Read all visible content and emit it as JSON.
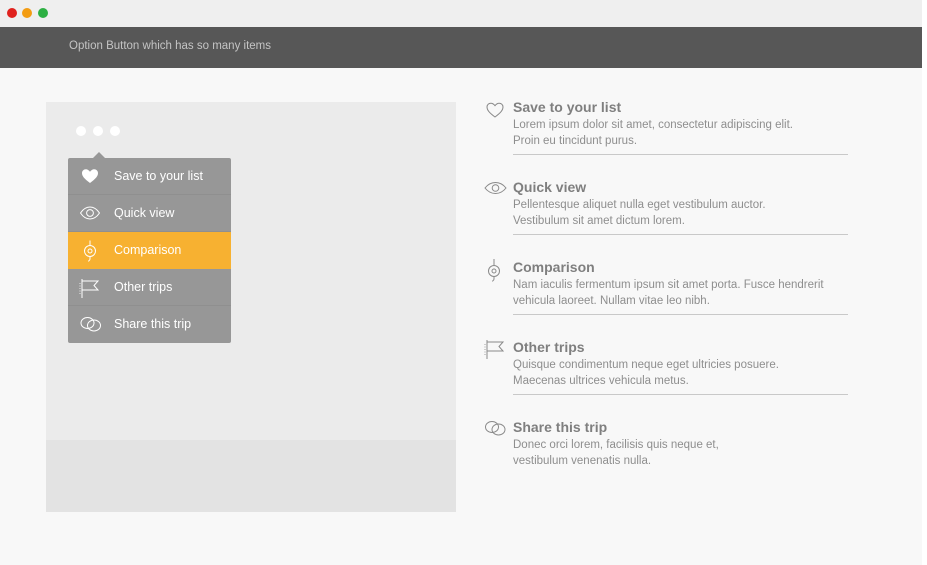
{
  "window": {
    "controls": [
      "close",
      "minimize",
      "maximize"
    ]
  },
  "header": {
    "title": "Option Button which has so many items"
  },
  "menu": {
    "items": [
      {
        "label": "Save to your list",
        "icon": "heart-icon",
        "active": false
      },
      {
        "label": "Quick view",
        "icon": "eye-icon",
        "active": false
      },
      {
        "label": "Comparison",
        "icon": "compass-icon",
        "active": true
      },
      {
        "label": "Other trips",
        "icon": "flag-icon",
        "active": false
      },
      {
        "label": "Share this trip",
        "icon": "share-icon",
        "active": false
      }
    ]
  },
  "features": [
    {
      "title": "Save to your list",
      "line1": "Lorem ipsum dolor sit amet, consectetur adipiscing elit.",
      "line2": "Proin eu tincidunt purus.",
      "icon": "heart-outline-icon"
    },
    {
      "title": "Quick view",
      "line1": "Pellentesque aliquet nulla eget vestibulum auctor.",
      "line2": "Vestibulum sit amet dictum lorem.",
      "icon": "eye-icon"
    },
    {
      "title": "Comparison",
      "line1": "Nam iaculis fermentum ipsum sit amet porta. Fusce hendrerit",
      "line2": "vehicula laoreet. Nullam vitae leo nibh.",
      "icon": "compass-icon"
    },
    {
      "title": "Other trips",
      "line1": "Quisque condimentum neque eget ultricies posuere.",
      "line2": "Maecenas ultrices vehicula metus.",
      "icon": "flag-icon"
    },
    {
      "title": "Share this trip",
      "line1": "Donec orci lorem, facilisis quis neque et,",
      "line2": "vestibulum venenatis nulla.",
      "icon": "share-icon"
    }
  ],
  "colors": {
    "accent": "#f7b131",
    "menu_bg": "#979797",
    "header_bg": "#575757"
  }
}
